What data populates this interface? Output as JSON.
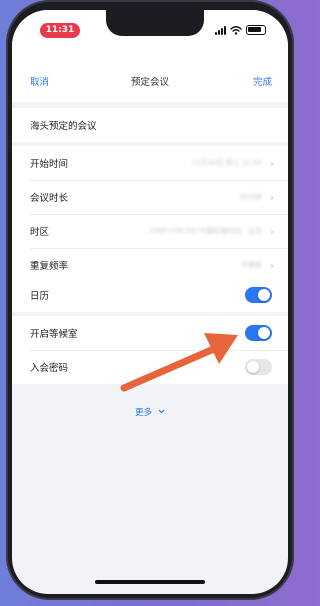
{
  "status_bar": {
    "time": "11:31"
  },
  "nav": {
    "cancel": "取消",
    "title": "预定会议",
    "done": "完成"
  },
  "meeting": {
    "topic": "海头预定的会议"
  },
  "schedule": {
    "start_time": {
      "label": "开始时间",
      "value": "11月30日 周三 12:00"
    },
    "duration": {
      "label": "会议时长",
      "value": "30分钟"
    },
    "timezone": {
      "label": "时区",
      "value": "(GMT+08:00) 中国标准时间 - 北京"
    },
    "repeat": {
      "label": "重复频率",
      "value": "不重复"
    }
  },
  "calendar": {
    "label": "日历",
    "enabled": true
  },
  "waiting_room": {
    "label": "开启等候室",
    "enabled": true
  },
  "password": {
    "label": "入会密码",
    "enabled": false
  },
  "more": {
    "label": "更多",
    "icon": "chevron-down-icon"
  },
  "colors": {
    "accent": "#2d7cf6",
    "toggle_on": "#2a77f2",
    "status_pill": "#e83a4a",
    "annotation_arrow": "#e8643a"
  }
}
